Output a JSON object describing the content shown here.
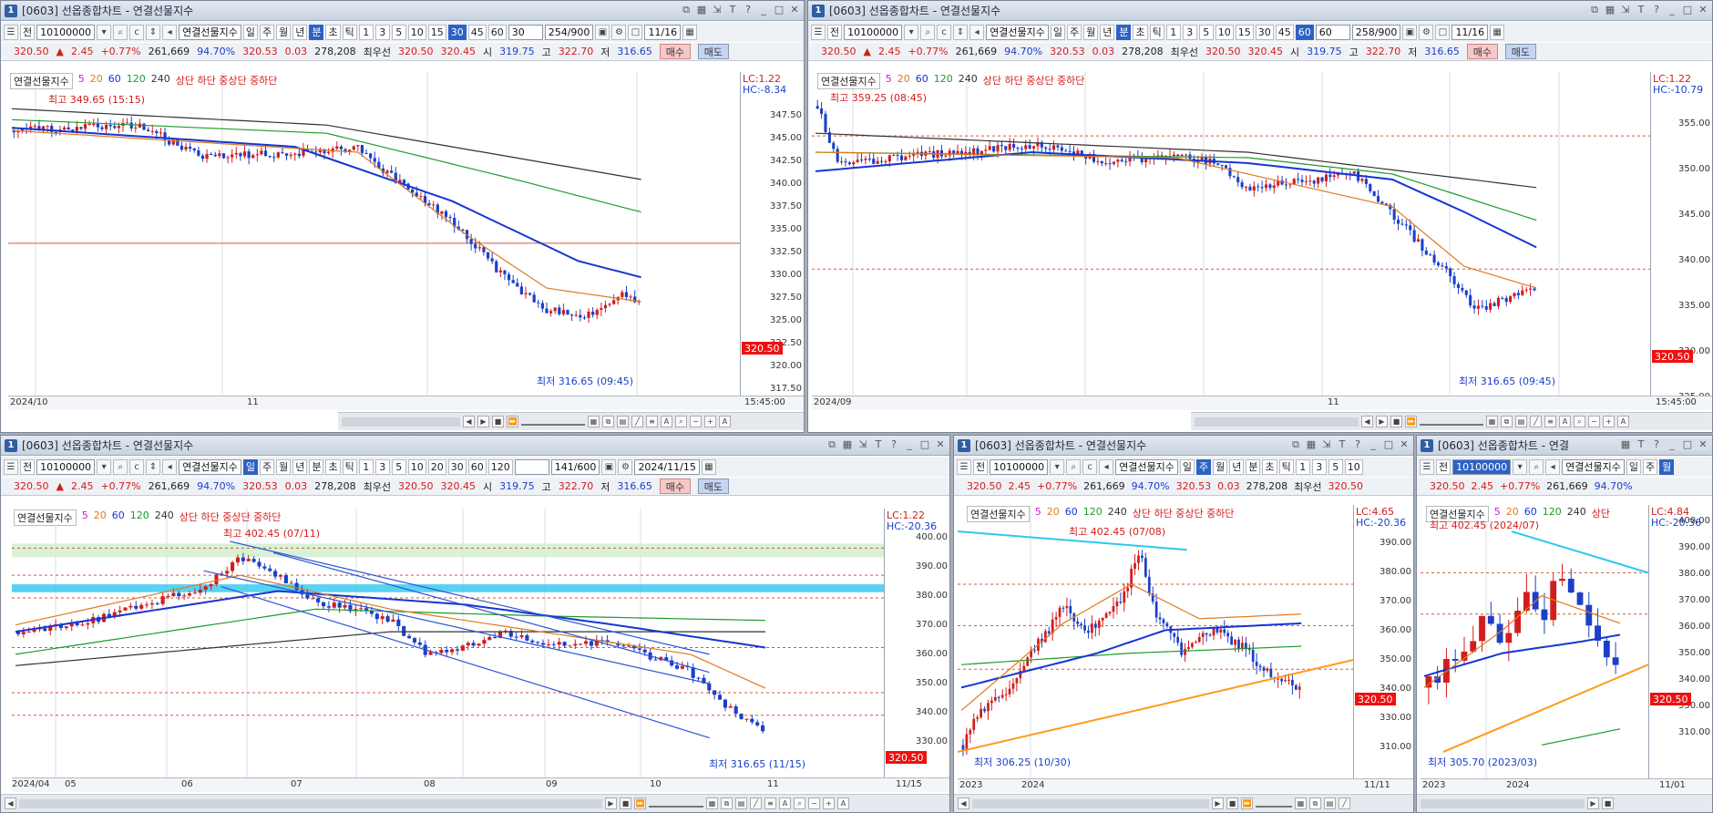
{
  "colors": {
    "up": "#d21d1d",
    "down": "#1c3fc9",
    "ma5": "#c81ec8",
    "ma20": "#e07a1e",
    "ma60": "#1536d0",
    "ma120": "#1f9a2a",
    "ma240": "#333333",
    "hline": "#d25a3a",
    "channel": "#2b55d9",
    "cyan": "#2ec7ee",
    "orange": "#ff9a1a",
    "accent": "#2d62c4"
  },
  "quote": {
    "price": "320.50",
    "arrow": "▲",
    "change": "2.45",
    "pct": "+0.77%",
    "volume": "261,669",
    "rate": "94.70%",
    "p2": "320.53",
    "p2chg": "0.03",
    "oi": "278,208",
    "label_best": "최우선",
    "bid": "320.50",
    "ask": "320.45",
    "l_open": "시",
    "open": "319.75",
    "l_high": "고",
    "high": "322.70",
    "l_low": "저",
    "low": "316.65",
    "buy": "매수",
    "sell": "매도"
  },
  "windows": [
    {
      "id": "w1",
      "num": "1",
      "title": "[0603] 선옵종합차트 - 연결선물지수",
      "toolbar": {
        "code": "10100000",
        "instrument": "연결선물지수",
        "periods": [
          "일",
          "주",
          "월",
          "년",
          "분",
          "초",
          "틱"
        ],
        "period_active": "분",
        "intervals": [
          "1",
          "3",
          "5",
          "10",
          "15",
          "30",
          "45",
          "60"
        ],
        "interval_active": "30",
        "count": "30",
        "range": "254/900",
        "date": "11/16"
      },
      "legend": {
        "name": "연결선물지수",
        "mas": [
          "5",
          "20",
          "60",
          "120",
          "240"
        ],
        "extra": "상단 하단 중상단 중하단"
      },
      "lc": "LC:1.22",
      "hc": "HC:-8.34",
      "yticks": [
        "347.50",
        "345.00",
        "342.50",
        "340.00",
        "337.50",
        "335.00",
        "332.50",
        "330.00",
        "327.50",
        "325.00",
        "322.50",
        "320.00",
        "317.50"
      ],
      "current": "320.50",
      "xlabels": [
        "2024/10",
        "11"
      ],
      "time_end": "15:45:00",
      "ann_high": "최고 349.65 (15:15)",
      "ann_low": "최저 316.65 (09:45)"
    },
    {
      "id": "w2",
      "num": "1",
      "title": "[0603] 선옵종합차트 - 연결선물지수",
      "toolbar": {
        "code": "10100000",
        "instrument": "연결선물지수",
        "periods": [
          "일",
          "주",
          "월",
          "년",
          "분",
          "초",
          "틱"
        ],
        "period_active": "분",
        "intervals": [
          "1",
          "3",
          "5",
          "10",
          "15",
          "30",
          "45",
          "60"
        ],
        "interval_active": "60",
        "count": "60",
        "range": "258/900",
        "date": "11/16"
      },
      "legend": {
        "name": "연결선물지수",
        "mas": [
          "5",
          "20",
          "60",
          "120",
          "240"
        ],
        "extra": "상단 하단 중상단 중하단"
      },
      "lc": "LC:1.22",
      "hc": "HC:-10.79",
      "yticks": [
        "355.00",
        "350.00",
        "345.00",
        "340.00",
        "335.00",
        "330.00",
        "325.00"
      ],
      "current": "320.50",
      "xlabels": [
        "2024/09",
        "11"
      ],
      "time_end": "15:45:00",
      "ann_high": "최고 359.25 (08:45)",
      "ann_low": "최저 316.65 (09:45)"
    },
    {
      "id": "w3",
      "num": "1",
      "title": "[0603] 선옵종합차트 - 연결선물지수",
      "toolbar": {
        "code": "10100000",
        "instrument": "연결선물지수",
        "periods": [
          "일",
          "주",
          "월",
          "년",
          "분",
          "초",
          "틱"
        ],
        "period_active": "일",
        "intervals": [
          "1",
          "3",
          "5",
          "10",
          "20",
          "30",
          "60",
          "120"
        ],
        "interval_active": "",
        "count": "",
        "range": "141/600",
        "date": "2024/11/15"
      },
      "legend": {
        "name": "연결선물지수",
        "mas": [
          "5",
          "20",
          "60",
          "120",
          "240"
        ],
        "extra": "상단 하단 중상단 중하단"
      },
      "lc": "LC:1.22",
      "hc": "HC:-20.36",
      "yticks": [
        "400.00",
        "390.00",
        "380.00",
        "370.00",
        "360.00",
        "350.00",
        "340.00",
        "330.00"
      ],
      "current": "320.50",
      "xlabels": [
        "2024/04",
        "05",
        "06",
        "07",
        "08",
        "09",
        "10",
        "11"
      ],
      "time_end": "11/15",
      "ann_high": "최고 402.45 (07/11)",
      "ann_low": "최저 316.65 (11/15)"
    },
    {
      "id": "w4",
      "num": "1",
      "title": "[0603] 선옵종합차트 - 연결선물지수",
      "toolbar": {
        "code": "10100000",
        "instrument": "연결선물지수",
        "periods": [
          "일",
          "주",
          "월",
          "년",
          "분",
          "초",
          "틱"
        ],
        "period_active": "주",
        "intervals": [
          "1",
          "3",
          "5",
          "10"
        ],
        "interval_active": "",
        "count": "",
        "range": "",
        "date": ""
      },
      "legend": {
        "name": "연결선물지수",
        "mas": [
          "5",
          "20",
          "60",
          "120",
          "240"
        ],
        "extra": "상단 하단 중상단 중하단"
      },
      "lc": "LC:4.65",
      "hc": "HC:-20.36",
      "yticks": [
        "390.00",
        "380.00",
        "370.00",
        "360.00",
        "350.00",
        "340.00",
        "330.00",
        "310.00"
      ],
      "current": "320.50",
      "xlabels": [
        "2023",
        "2024"
      ],
      "time_end": "11/11",
      "ann_high": "최고 402.45 (07/08)",
      "ann_low": "최저 306.25 (10/30)"
    },
    {
      "id": "w5",
      "num": "1",
      "title": "[0603] 선옵종합차트 - 연결",
      "toolbar": {
        "code": "10100000",
        "instrument": "연결선물지수",
        "periods": [
          "일",
          "주",
          "월"
        ],
        "period_active": "월",
        "intervals": [],
        "interval_active": "",
        "count": "",
        "range": "",
        "date": ""
      },
      "legend": {
        "name": "연결선물지수",
        "mas": [
          "5",
          "20",
          "60",
          "120",
          "240"
        ],
        "extra": "상단"
      },
      "lc": "LC:4.84",
      "hc": "HC:-20.36",
      "yticks": [
        "400.00",
        "390.00",
        "380.00",
        "370.00",
        "360.00",
        "350.00",
        "340.00",
        "330.00",
        "310.00"
      ],
      "current": "320.50",
      "xlabels": [
        "2023",
        "2024"
      ],
      "time_end": "11/01",
      "ann_high": "최고 402.45 (2024/07)",
      "ann_low": "최저 305.70 (2023/03)"
    }
  ]
}
